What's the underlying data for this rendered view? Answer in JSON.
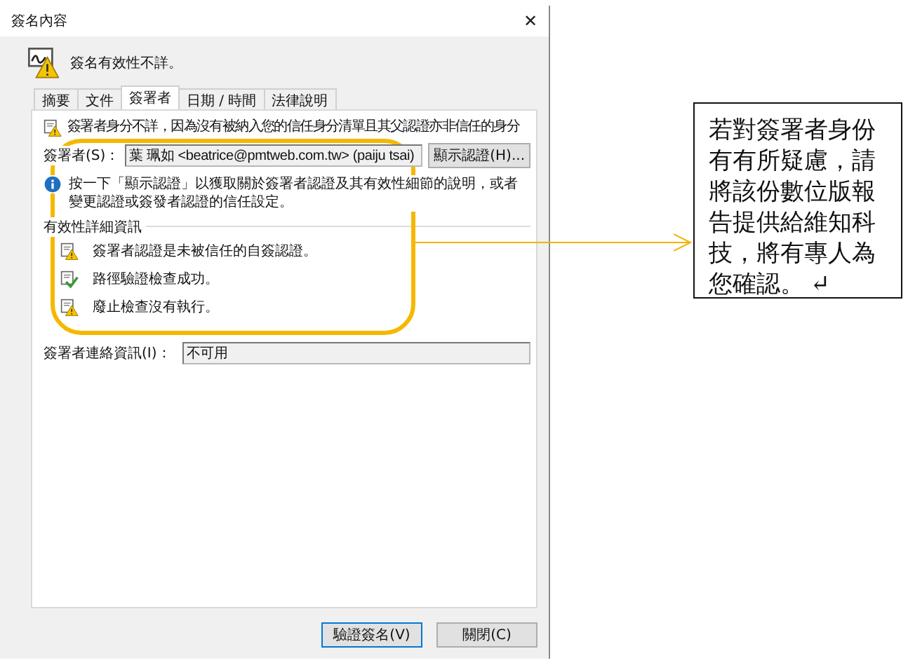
{
  "dialog": {
    "title": "簽名內容",
    "close": "✕",
    "status": "簽名有效性不詳。",
    "tabs": [
      {
        "label": "摘要",
        "selected": false
      },
      {
        "label": "文件",
        "selected": false
      },
      {
        "label": "簽署者",
        "selected": true
      },
      {
        "label": "日期 / 時間",
        "selected": false
      },
      {
        "label": "法律說明",
        "selected": false
      }
    ],
    "identity_notice": "簽署者身分不詳，因為沒有被納入您的信任身分清單且其父認證亦非信任的身分",
    "signer": {
      "label": "簽署者(S)：",
      "value": "葉 珮如 <beatrice@pmtweb.com.tw> (paiju tsai)"
    },
    "show_cert_button": "顯示認證(H)...",
    "info_note": "按一下「顯示認證」以獲取關於簽署者認證及其有效性細節的說明，或者變更認證或簽發者認證的信任設定。",
    "validity": {
      "legend": "有效性詳細資訊",
      "items": [
        {
          "kind": "warning",
          "text": "簽署者認證是未被信任的自簽認證。"
        },
        {
          "kind": "ok",
          "text": "路徑驗證檢查成功。"
        },
        {
          "kind": "warning",
          "text": "廢止檢查沒有執行。"
        }
      ]
    },
    "contact": {
      "label": "簽署者連絡資訊(I)：",
      "value": "不可用"
    },
    "buttons": [
      {
        "label": "驗證簽名(V)",
        "default": true
      },
      {
        "label": "關閉(C)",
        "default": false
      }
    ]
  },
  "callout": {
    "text": "若對簽署者身份有有所疑慮，請將該份數位版報告提供給維知科技，將有專人為您確認。",
    "mark": "↵"
  }
}
